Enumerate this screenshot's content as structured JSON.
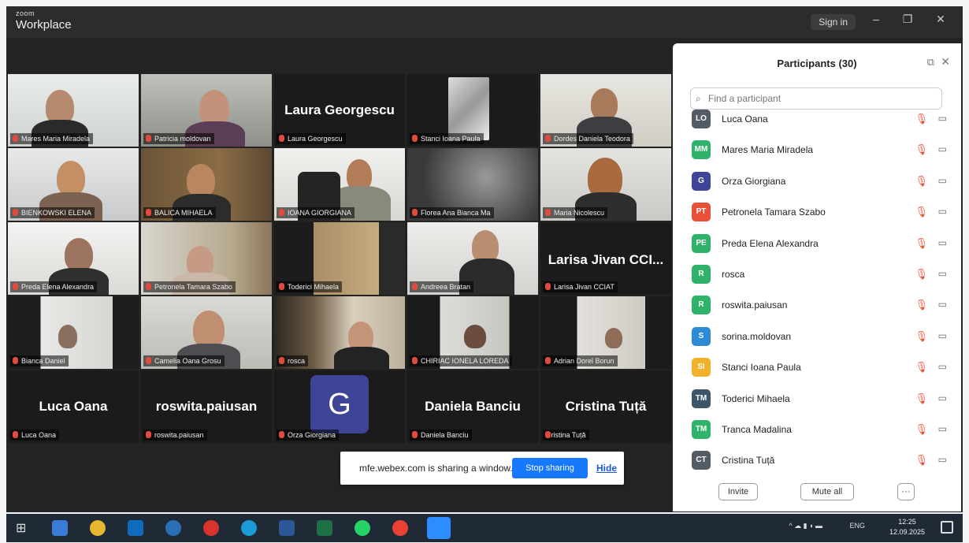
{
  "app": {
    "brand_top": "zoom",
    "brand": "Workplace",
    "sign_in": "Sign in"
  },
  "tiles_row1": [
    "Mares Maria Miradela",
    "Patricia moldovan",
    "Laura Georgescu",
    "Stanci Ioana Paula",
    "Dordes Daniela Teodora"
  ],
  "tiles_row2": [
    "BIENKOWSKI ELENA",
    "BALICA MIHAELA",
    "IOANA GIORGIANA",
    "Florea Ana Bianca Ma",
    "Maria Nicolescu"
  ],
  "tiles_row3": [
    "Preda Elena Alexandra",
    "Petronela Tamara Szabo",
    "Toderici Mihaela",
    "Andreea Bratan",
    "Larisa Jivan CCIAT"
  ],
  "tiles_row4": [
    "Bianca Daniel",
    "Camelia Oana Grosu",
    "rosca",
    "CHIRIAC IONELA LOREDA",
    "Adrian Dorel Borun"
  ],
  "tiles_row5": [
    "Luca Oana",
    "roswita.paiusan",
    "Orza Giorgiana",
    "Daniela Banciu",
    "Cristina Tuță"
  ],
  "big_names": {
    "laura": "Laura Georgescu",
    "larisa": "Larisa Jivan CCI...",
    "luca": "Luca Oana",
    "roswita": "roswita.paiusan",
    "daniela": "Daniela Banciu",
    "cristina": "Cristina Tuță",
    "orza_initial": "G"
  },
  "share": {
    "text": "mfe.webex.com is sharing a window.",
    "stop": "Stop sharing",
    "hide": "Hide"
  },
  "panel": {
    "title": "Participants (30)",
    "search_placeholder": "Find a participant",
    "invite": "Invite",
    "mute_all": "Mute all",
    "more": "···",
    "participants": [
      {
        "initials": "LO",
        "name": "Luca Oana",
        "color": "#555b66"
      },
      {
        "initials": "MM",
        "name": "Mares Maria Miradela",
        "color": "#2fb36a"
      },
      {
        "initials": "G",
        "name": "Orza Giorgiana",
        "color": "#3e4596"
      },
      {
        "initials": "PT",
        "name": "Petronela Tamara Szabo",
        "color": "#e8503a"
      },
      {
        "initials": "PE",
        "name": "Preda Elena Alexandra",
        "color": "#2fb36a"
      },
      {
        "initials": "R",
        "name": "rosca",
        "color": "#2fb36a"
      },
      {
        "initials": "R",
        "name": "roswita.paiusan",
        "color": "#2fb36a"
      },
      {
        "initials": "S",
        "name": "sorina.moldovan",
        "color": "#2d8bd6"
      },
      {
        "initials": "SI",
        "name": "Stanci Ioana Paula",
        "color": "#f2b12b"
      },
      {
        "initials": "TM",
        "name": "Toderici Mihaela",
        "color": "#3d5566"
      },
      {
        "initials": "TM",
        "name": "Tranca Madalina",
        "color": "#2fb36a"
      },
      {
        "initials": "CT",
        "name": "Cristina Tuță",
        "color": "#555b66"
      }
    ]
  },
  "taskbar": {
    "lang": "ENG",
    "time": "12:25",
    "date": "12.09.2025"
  }
}
